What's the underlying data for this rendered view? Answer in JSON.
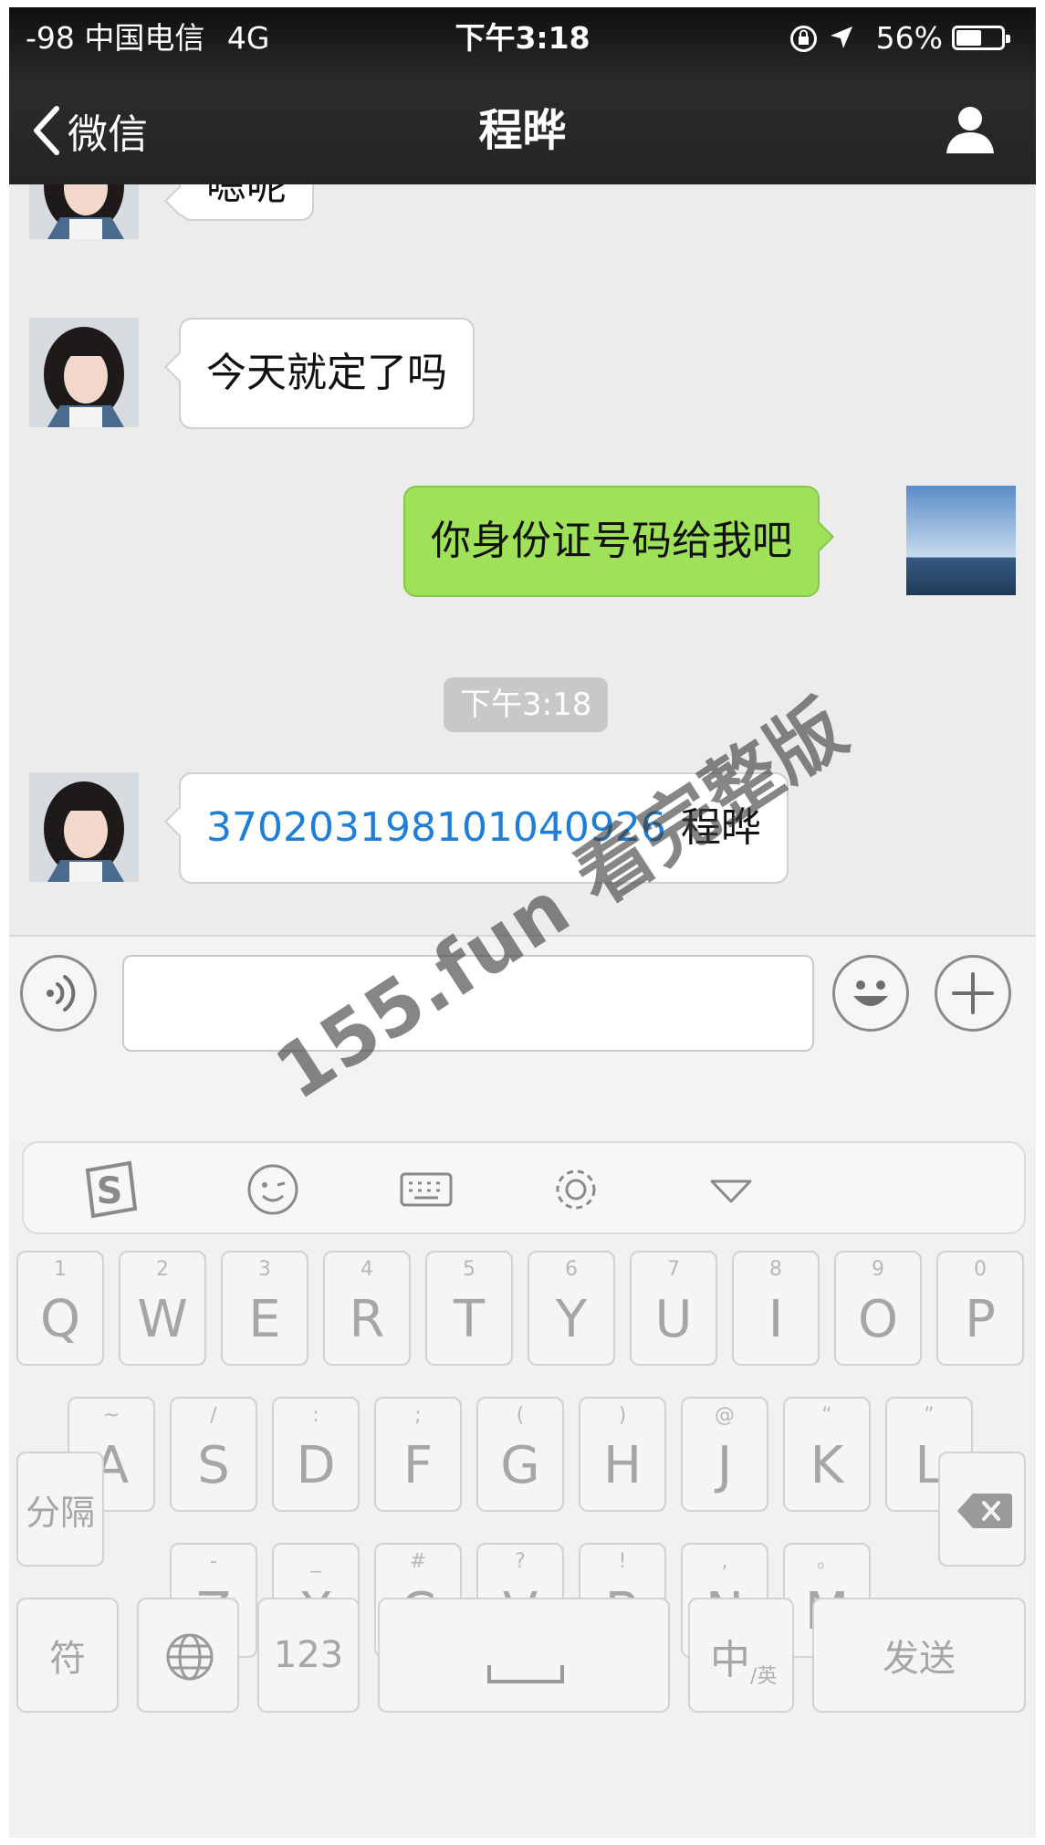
{
  "status_bar": {
    "signal": "-98",
    "carrier": "中国电信",
    "network": "4G",
    "time": "下午3:18",
    "battery": "56%",
    "battery_level": 0.56
  },
  "nav": {
    "back_label": "微信",
    "title": "程晔"
  },
  "messages": [
    {
      "side": "in",
      "text": "嗯呢"
    },
    {
      "side": "in",
      "text": "今天就定了吗"
    },
    {
      "side": "out",
      "text": "你身份证号码给我吧"
    },
    {
      "side": "in",
      "link": "370203198101040926",
      "text": "程晔"
    }
  ],
  "time_separator": "下午3:18",
  "input": {
    "placeholder": "",
    "value": ""
  },
  "keyboard": {
    "row1": [
      {
        "main": "Q",
        "sub": "1"
      },
      {
        "main": "W",
        "sub": "2"
      },
      {
        "main": "E",
        "sub": "3"
      },
      {
        "main": "R",
        "sub": "4"
      },
      {
        "main": "T",
        "sub": "5"
      },
      {
        "main": "Y",
        "sub": "6"
      },
      {
        "main": "U",
        "sub": "7"
      },
      {
        "main": "I",
        "sub": "8"
      },
      {
        "main": "O",
        "sub": "9"
      },
      {
        "main": "P",
        "sub": "0"
      }
    ],
    "row2": [
      {
        "main": "A",
        "sub": "~"
      },
      {
        "main": "S",
        "sub": "/"
      },
      {
        "main": "D",
        "sub": ":"
      },
      {
        "main": "F",
        "sub": ";"
      },
      {
        "main": "G",
        "sub": "("
      },
      {
        "main": "H",
        "sub": ")"
      },
      {
        "main": "J",
        "sub": "@"
      },
      {
        "main": "K",
        "sub": "“"
      },
      {
        "main": "L",
        "sub": "”"
      }
    ],
    "row3": [
      {
        "main": "Z",
        "sub": "-"
      },
      {
        "main": "X",
        "sub": "_"
      },
      {
        "main": "C",
        "sub": "#"
      },
      {
        "main": "V",
        "sub": "?"
      },
      {
        "main": "B",
        "sub": "!"
      },
      {
        "main": "N",
        "sub": ","
      },
      {
        "main": "M",
        "sub": "。"
      }
    ],
    "separator_label": "分隔",
    "symbol_label": "符",
    "numbers_label": "123",
    "lang_main": "中",
    "lang_sub": "/英",
    "send_label": "发送"
  },
  "watermark": "155.fun 看完整版",
  "colors": {
    "nav_bg": "#222222",
    "chat_bg": "#ececec",
    "out_bubble": "#9fe25a",
    "link": "#1f7fd6"
  }
}
